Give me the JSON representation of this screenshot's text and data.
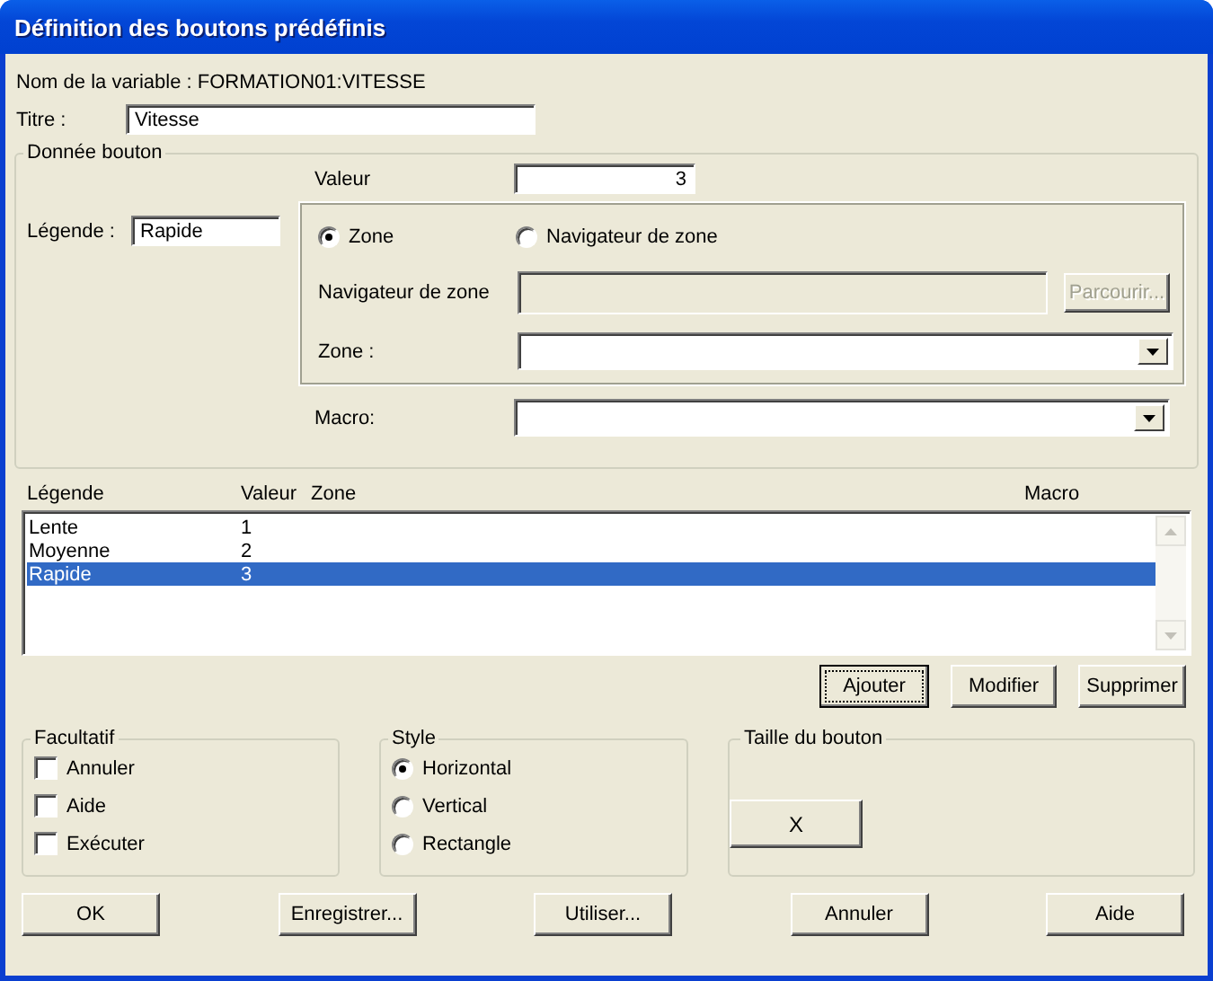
{
  "window": {
    "title": "Définition des boutons prédéfinis"
  },
  "variable_name": "Nom de la variable : FORMATION01:VITESSE",
  "title_field": {
    "label": "Titre :",
    "value": "Vitesse"
  },
  "button_data": {
    "legend": "Donnée bouton",
    "value_label": "Valeur",
    "value": "3",
    "caption_label": "Légende :",
    "caption_value": "Rapide",
    "source_options": [
      {
        "label": "Zone",
        "selected": true
      },
      {
        "label": "Navigateur de zone",
        "selected": false
      }
    ],
    "browser_label": "Navigateur de zone",
    "browser_disabled": true,
    "browse_button": {
      "label": "Parcourir...",
      "disabled": true
    },
    "zone_label": "Zone :",
    "macro_label": "Macro:"
  },
  "list": {
    "columns": [
      "Légende",
      "Valeur",
      "Zone",
      "Macro"
    ],
    "rows": [
      {
        "legend": "Lente",
        "value": "1",
        "selected": false
      },
      {
        "legend": "Moyenne",
        "value": "2",
        "selected": false
      },
      {
        "legend": "Rapide",
        "value": "3",
        "selected": true
      }
    ]
  },
  "list_buttons": [
    {
      "label": "Ajouter",
      "focused": true
    },
    {
      "label": "Modifier",
      "focused": false
    },
    {
      "label": "Supprimer",
      "focused": false
    }
  ],
  "optional": {
    "legend": "Facultatif",
    "items": [
      {
        "label": "Annuler",
        "checked": false
      },
      {
        "label": "Aide",
        "checked": false
      },
      {
        "label": "Exécuter",
        "checked": false
      }
    ]
  },
  "style": {
    "legend": "Style",
    "items": [
      {
        "label": "Horizontal",
        "selected": true
      },
      {
        "label": "Vertical",
        "selected": false
      },
      {
        "label": "Rectangle",
        "selected": false
      }
    ]
  },
  "size": {
    "legend": "Taille du bouton",
    "preview": "X"
  },
  "footer_buttons": [
    "OK",
    "Enregistrer...",
    "Utiliser...",
    "Annuler",
    "Aide"
  ]
}
